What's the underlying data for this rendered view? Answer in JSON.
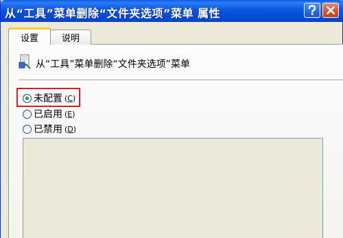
{
  "window": {
    "title": "从“工具”菜单删除“文件夹选项”菜单 属性"
  },
  "titlebar_buttons": {
    "help": "?",
    "close": "×"
  },
  "tabs": [
    {
      "label": "设置",
      "selected": true
    },
    {
      "label": "说明",
      "selected": false
    }
  ],
  "policy": {
    "name": "从“工具”菜单删除“文件夹选项”菜单",
    "icon": "policy-setting-icon"
  },
  "options": [
    {
      "label": "未配置",
      "accel": "C",
      "checked": true
    },
    {
      "label": "已启用",
      "accel": "E",
      "checked": false
    },
    {
      "label": "已禁用",
      "accel": "D",
      "checked": false
    }
  ],
  "colors": {
    "title_bar": "#0a56e0",
    "highlight_box": "#d61f1f",
    "radio_dot": "#21a121",
    "tab_accent": "#ffc83c"
  }
}
